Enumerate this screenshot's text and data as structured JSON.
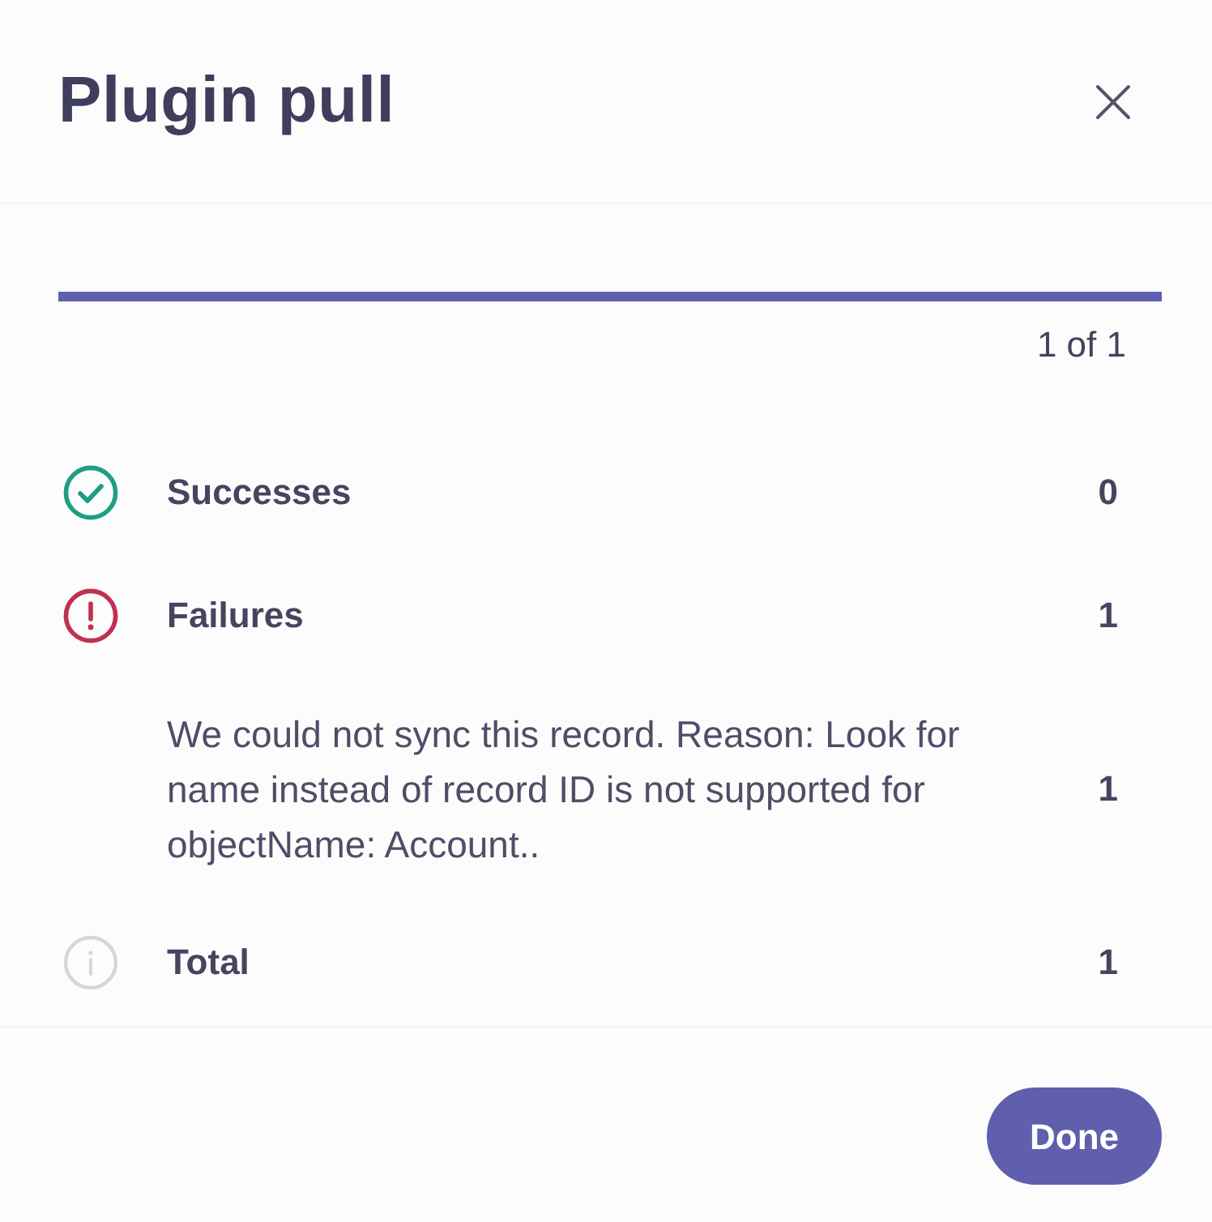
{
  "dialog": {
    "title": "Plugin pull"
  },
  "progress": {
    "level": 1,
    "label": "1 of 1"
  },
  "results": [
    {
      "kind": "success",
      "label": "Successes",
      "count": "0"
    },
    {
      "kind": "failure",
      "label": "Failures",
      "count": "1"
    },
    {
      "kind": "reason",
      "text": "We could not sync this record. Reason: Look for name instead of record ID is not supported for objectName: Account..",
      "count": "1"
    },
    {
      "kind": "total",
      "label": "Total",
      "count": "1"
    }
  ],
  "footer": {
    "button": "Done"
  }
}
